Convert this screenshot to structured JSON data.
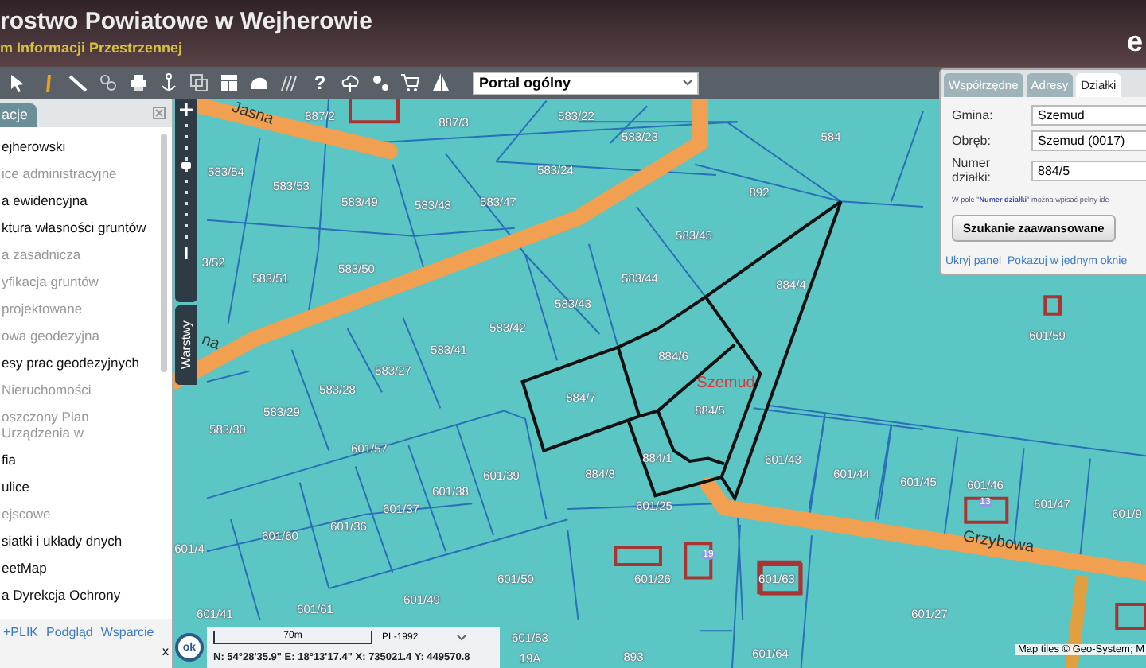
{
  "header": {
    "title": "rostwo Powiatowe w Wejherowie",
    "subtitle": "m Informacji Przestrzennej",
    "corner": "e"
  },
  "toolbar": {
    "help_glyph": "?",
    "portal_select": {
      "value": "Portal ogólny"
    }
  },
  "sidebar": {
    "tab": {
      "label": "acje",
      "selected": true
    },
    "items": [
      {
        "label": "ejherowski",
        "disabled": false
      },
      {
        "label": "ice administracyjne",
        "disabled": true
      },
      {
        "label": "a ewidencyjna",
        "disabled": false
      },
      {
        "label": "ktura własności gruntów",
        "disabled": false
      },
      {
        "label": "a zasadnicza",
        "disabled": true
      },
      {
        "label": "yfikacja gruntów",
        "disabled": true
      },
      {
        "label": "projektowane",
        "disabled": true
      },
      {
        "label": "owa geodezyjna",
        "disabled": true
      },
      {
        "label": "esy prac geodezyjnych",
        "disabled": false
      },
      {
        "label": "Nieruchomości",
        "disabled": true
      },
      {
        "label": "oszczony Plan Urządzenia w",
        "disabled": true
      },
      {
        "label": "fia",
        "disabled": false
      },
      {
        "label": "ulice",
        "disabled": false
      },
      {
        "label": "ejscowe",
        "disabled": true
      },
      {
        "label": "siatki i układy dnych",
        "disabled": false
      },
      {
        "label": "eetMap",
        "disabled": false
      },
      {
        "label": "a Dyrekcja Ochrony",
        "disabled": false
      }
    ],
    "footer_links": [
      "+PLIK",
      "Podgląd",
      "Wsparcie"
    ],
    "close_label": "x"
  },
  "map": {
    "layers_tab": "Warstwy",
    "streets": [
      "Jasna",
      "na",
      "Grzybowa"
    ],
    "parcels": [
      "887/2",
      "887/3",
      "583/22",
      "583/23",
      "584",
      "583/54",
      "583/24",
      "583/53",
      "892",
      "583/49",
      "583/48",
      "583/47",
      "583/45",
      "3/52",
      "583/51",
      "583/50",
      "583/44",
      "884/4",
      "583/43",
      "583/42",
      "601/59",
      "583/41",
      "884/6",
      "583/27",
      "583/28",
      "884/7",
      "583/29",
      "884/5",
      "583/30",
      "601/57",
      "884/1",
      "601/43",
      "601/39",
      "884/8",
      "601/44",
      "601/38",
      "601/45",
      "601/46",
      "601/37",
      "601/25",
      "601/47",
      "601/9",
      "601/60",
      "601/36",
      "601/4",
      "601/50",
      "601/26",
      "601/63",
      "601/41",
      "601/61",
      "601/49",
      "601/27",
      "601/53",
      "19A",
      "893",
      "601/64"
    ],
    "zoom_slider": {
      "level": 0.72
    },
    "municipality_label": "Szemud",
    "house_numbers": [
      "19",
      "13"
    ],
    "attribution": "Map tiles © Geo-System; M",
    "ok_button": "ok",
    "scale": "70m",
    "projection": "PL-1992",
    "coordinates": "N: 54°28'35.9\" E: 18°13'17.4\" X: 735021.4 Y: 449570.8"
  },
  "search_panel": {
    "tabs": [
      {
        "label": "Współrzędne",
        "selected": false
      },
      {
        "label": "Adresy",
        "selected": false
      },
      {
        "label": "Działki",
        "selected": true
      }
    ],
    "fields": [
      {
        "label": "Gmina:",
        "value": "Szemud"
      },
      {
        "label": "Obręb:",
        "value": "Szemud (0017)"
      },
      {
        "label": "Numer działki:",
        "value": "884/5"
      }
    ],
    "hint": "W pole \"**Numer działki**\" można wpisać pełny ide",
    "button": "Szukanie zaawansowane",
    "links": [
      "Ukryj panel",
      "Pokazuj w jednym oknie"
    ]
  }
}
